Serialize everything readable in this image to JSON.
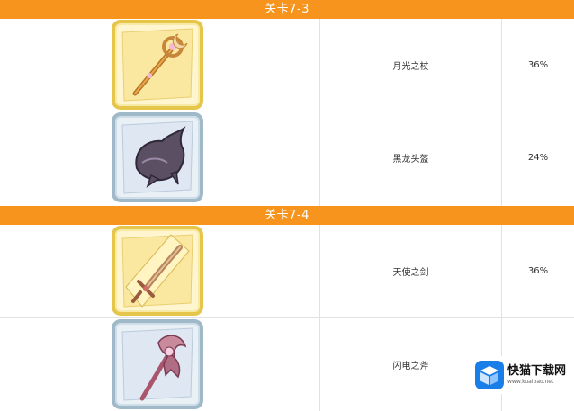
{
  "stages": [
    {
      "title": "关卡7-3",
      "items": [
        {
          "name": "月光之杖",
          "rate": "36%",
          "icon": "moonlight-staff-icon",
          "frame": "gold"
        },
        {
          "name": "黑龙头盔",
          "rate": "24%",
          "icon": "black-dragon-helmet-icon",
          "frame": "blue"
        }
      ]
    },
    {
      "title": "关卡7-4",
      "items": [
        {
          "name": "天使之剑",
          "rate": "36%",
          "icon": "angel-sword-icon",
          "frame": "gold"
        },
        {
          "name": "闪电之斧",
          "rate": "",
          "icon": "lightning-axe-icon",
          "frame": "blue"
        }
      ]
    }
  ],
  "watermark": {
    "title": "快猫下载网",
    "subtitle": "www.kuaibao.net"
  },
  "colors": {
    "header": "#f7941d",
    "frame_gold": "#e6c64a",
    "frame_blue": "#9fb9c9",
    "watermark_logo": "#1a7ee8"
  }
}
